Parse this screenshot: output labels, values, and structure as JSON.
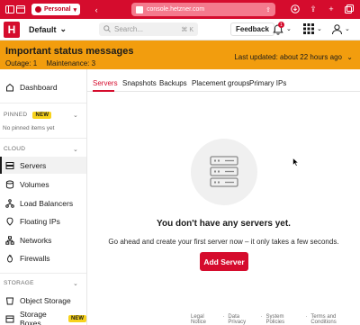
{
  "browser": {
    "profile_label": "Personal",
    "url": "console.hetzner.com"
  },
  "header": {
    "logo_letter": "H",
    "project": "Default",
    "search_placeholder": "Search...",
    "search_shortcut": "⌘ K",
    "feedback_label": "Feedback",
    "notification_count": "1"
  },
  "status": {
    "title": "Important status messages",
    "outage": "Outage: 1",
    "maintenance": "Maintenance: 3",
    "updated": "Last updated: about 22 hours ago"
  },
  "sidebar": {
    "dashboard": "Dashboard",
    "pinned_label": "PINNED",
    "pinned_badge": "NEW",
    "pinned_hint": "No pinned items yet",
    "cloud_label": "CLOUD",
    "cloud_items": [
      "Servers",
      "Volumes",
      "Load Balancers",
      "Floating IPs",
      "Networks",
      "Firewalls"
    ],
    "storage_label": "STORAGE",
    "storage_items": [
      "Object Storage",
      "Storage Boxes"
    ],
    "storage_badge": "NEW"
  },
  "tabs": [
    "Servers",
    "Snapshots",
    "Backups",
    "Placement groups",
    "Primary IPs"
  ],
  "empty_state": {
    "title": "You don't have any servers yet.",
    "description": "Go ahead and create your first server now – it only takes a few seconds.",
    "button": "Add Server"
  },
  "footer": [
    "Legal Notice",
    "·",
    "Data Privacy",
    "·",
    "System Policies",
    "·",
    "Terms and Conditions"
  ],
  "colors": {
    "brand": "#d50c2d",
    "banner": "#f29d0e",
    "badge": "#f7d21c"
  }
}
